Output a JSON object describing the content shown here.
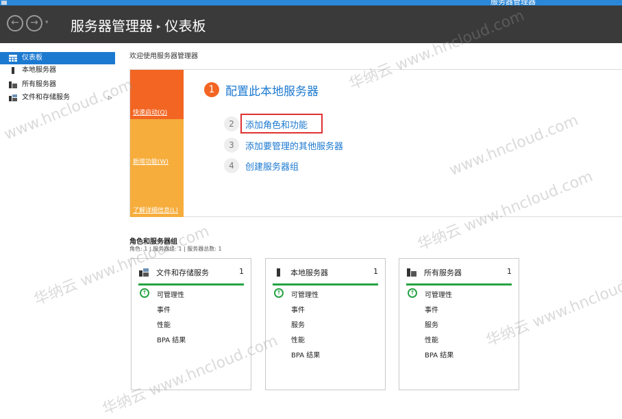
{
  "window": {
    "title": "服务器管理器"
  },
  "header": {
    "back_icon": "back-arrow-icon",
    "forward_icon": "forward-arrow-icon",
    "dropdown_glyph": "▾",
    "breadcrumb": {
      "root": "服务器管理器",
      "separator": "▸",
      "current": "仪表板"
    }
  },
  "sidebar": {
    "items": [
      {
        "label": "仪表板",
        "icon": "dashboard-icon",
        "active": true
      },
      {
        "label": "本地服务器",
        "icon": "server-icon",
        "active": false
      },
      {
        "label": "所有服务器",
        "icon": "servers-icon",
        "active": false
      },
      {
        "label": "文件和存储服务",
        "icon": "file-storage-icon",
        "active": false,
        "has_submenu": true,
        "arrow": "▷"
      }
    ]
  },
  "main": {
    "welcome_title": "欢迎使用服务器管理器",
    "quick_sections": [
      {
        "label": "快速启动(Q)"
      },
      {
        "label": "新增功能(W)"
      },
      {
        "label": "了解详细信息(L)"
      }
    ],
    "steps": [
      {
        "num": "1",
        "text": "配置此本地服务器"
      },
      {
        "num": "2",
        "text": "添加角色和功能"
      },
      {
        "num": "3",
        "text": "添加要管理的其他服务器"
      },
      {
        "num": "4",
        "text": "创建服务器组"
      }
    ],
    "roles": {
      "title": "角色和服务器组",
      "subtitle": "角色: 1 | 服务器组: 1 | 服务器总数: 1",
      "cards": [
        {
          "title": "文件和存储服务",
          "count": "1",
          "icon": "file-storage-icon",
          "rows": [
            "可管理性",
            "事件",
            "性能",
            "BPA 结果"
          ]
        },
        {
          "title": "本地服务器",
          "count": "1",
          "icon": "server-icon",
          "rows": [
            "可管理性",
            "事件",
            "服务",
            "性能",
            "BPA 结果"
          ]
        },
        {
          "title": "所有服务器",
          "count": "1",
          "icon": "servers-icon",
          "rows": [
            "可管理性",
            "事件",
            "服务",
            "性能",
            "BPA 结果"
          ]
        }
      ]
    }
  },
  "watermarks": [
    "www.hncloud.com",
    "华纳云 www.hncloud.com"
  ],
  "colors": {
    "header_bg": "#3a3a3a",
    "accent_blue": "#1c79d0",
    "quickstart_orange": "#f26522",
    "quick_light_orange": "#f6ad3c",
    "status_green": "#25a244",
    "highlight_red": "#e03030"
  }
}
